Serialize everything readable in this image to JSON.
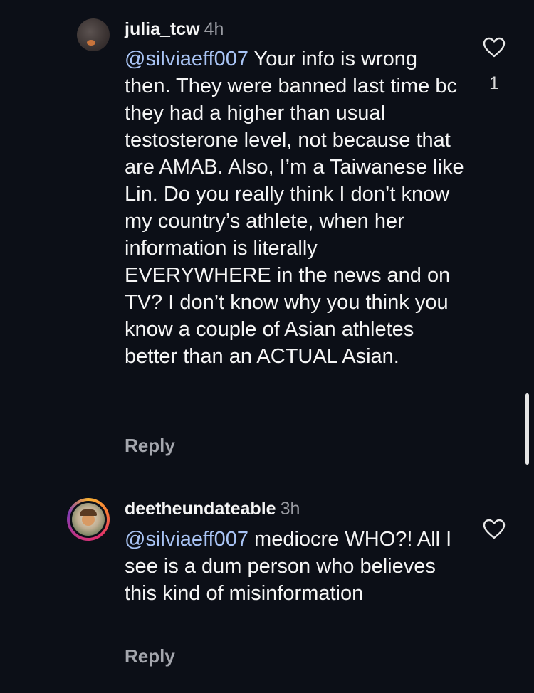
{
  "comments": [
    {
      "username": "julia_tcw",
      "time": "4h",
      "mention": "@silviaeff007",
      "text": " Your info is wrong then. They were banned last time bc they had a higher than usual testosterone level, not because that are AMAB. Also, I’m a Taiwanese like Lin. Do you really think I don’t know my country’s athlete, when her information is literally EVERYWHERE in the news and on TV? I don’t know why you think you know a couple of Asian athletes better than an ACTUAL Asian.",
      "reply_label": "Reply",
      "like_count": "1",
      "avatar_icon": "profile-photo"
    },
    {
      "username": "deetheundateable",
      "time": "3h",
      "mention": "@silviaeff007",
      "text": " mediocre WHO?! All I see is a dum person who believes this kind of misinformation",
      "reply_label": "Reply",
      "avatar_icon": "story-ring-profile-photo"
    }
  ],
  "colors": {
    "background": "#0c0f17",
    "text": "#f5f5f5",
    "mention": "#a9c4f5",
    "secondary": "#a4a6ad"
  },
  "icons": {
    "like": "heart-icon"
  }
}
